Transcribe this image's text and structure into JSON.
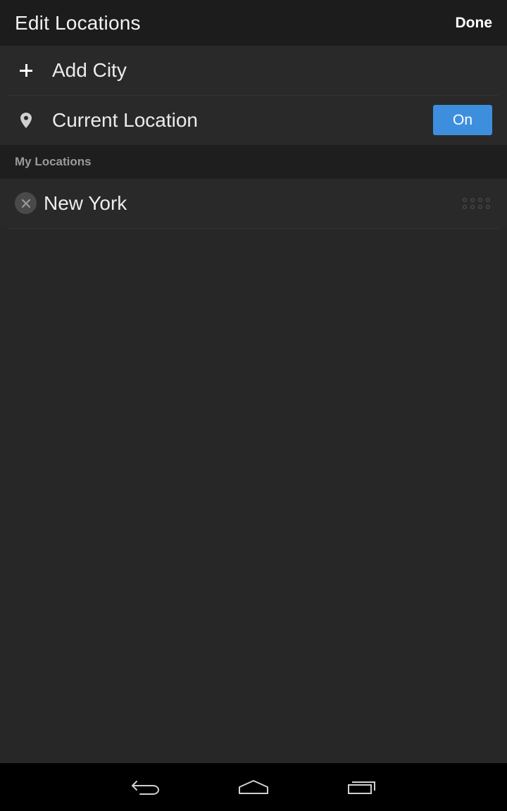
{
  "action_bar": {
    "title": "Edit Locations",
    "done_label": "Done"
  },
  "add_city": {
    "label": "Add City",
    "icon": "plus-icon"
  },
  "current_location": {
    "label": "Current Location",
    "icon": "location-pin-icon",
    "toggle_label": "On",
    "toggle_color": "#3d8fde"
  },
  "my_locations": {
    "header": "My Locations",
    "cities": [
      {
        "name": "New York"
      }
    ]
  },
  "nav_bar": {
    "buttons": [
      "back-icon",
      "home-icon",
      "recent-apps-icon"
    ]
  }
}
